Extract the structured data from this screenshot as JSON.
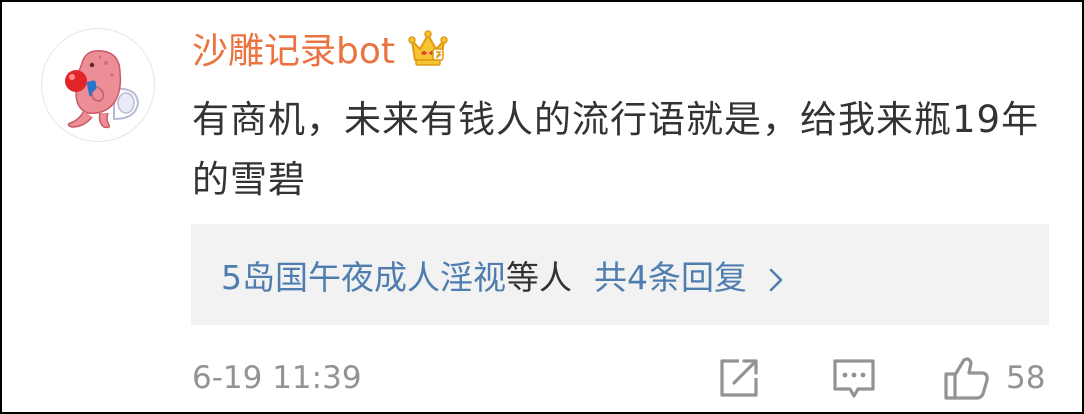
{
  "comment": {
    "username": "沙雕记录bot",
    "badge_icon": "crown-badge-icon",
    "text": "有商机，未来有钱人的流行语就是，给我来瓶19年的雪碧",
    "timestamp": "6-19 11:39",
    "like_count": "58"
  },
  "replies": {
    "names": "5岛国午夜成人淫视",
    "names_suffix": "等人",
    "count_label": "共4条回复"
  },
  "colors": {
    "username": "#eb7340",
    "link": "#507daf",
    "text": "#333333",
    "meta": "#939393",
    "reply_bg": "#f2f2f2"
  }
}
